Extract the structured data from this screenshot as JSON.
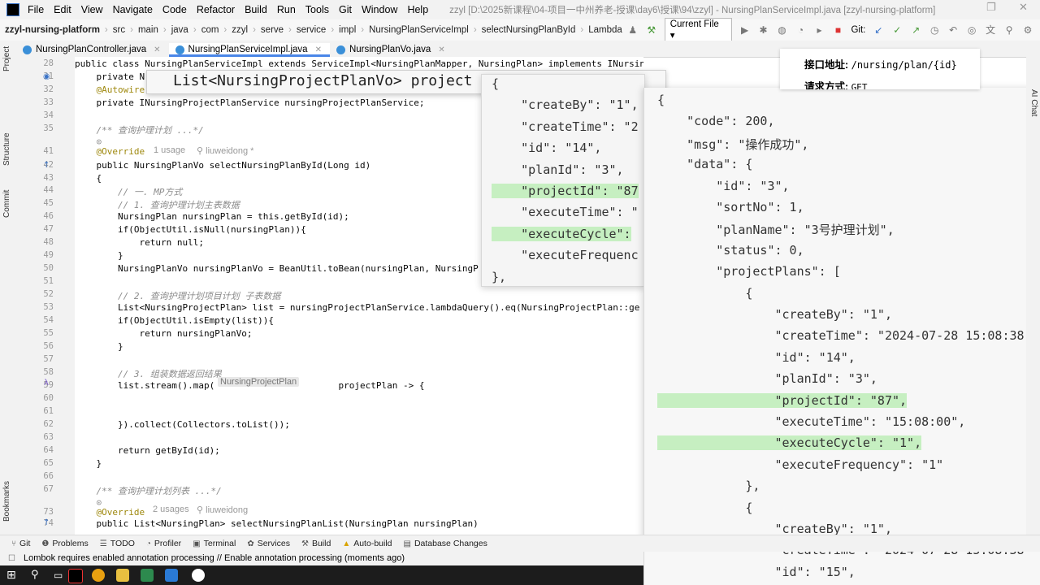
{
  "menubar": {
    "items": [
      "File",
      "Edit",
      "View",
      "Navigate",
      "Code",
      "Refactor",
      "Build",
      "Run",
      "Tools",
      "Git",
      "Window",
      "Help"
    ],
    "title": "zzyl [D:\\2025新课程\\04-项目一中州养老-授课\\day6\\授课\\94\\zzyl] - NursingPlanServiceImpl.java [zzyl-nursing-platform]"
  },
  "breadcrumb": [
    "zzyl-nursing-platform",
    "src",
    "main",
    "java",
    "com",
    "zzyl",
    "serve",
    "service",
    "impl",
    "NursingPlanServiceImpl",
    "selectNursingPlanById",
    "Lambda"
  ],
  "toolbar": {
    "current_file": "Current File",
    "git_label": "Git:"
  },
  "tabs": [
    "NursingPlanController.java",
    "NursingPlanServiceImpl.java",
    "NursingPlanVo.java"
  ],
  "sidebar_left": {
    "project": "Project",
    "structure": "Structure",
    "commit": "Commit",
    "bookmarks": "Bookmarks"
  },
  "sidebar_right": {
    "chat": "AI Chat"
  },
  "editor": {
    "lines": [
      {
        "n": "28",
        "text": "public class NursingPlanServiceImpl extends ServiceImpl<NursingPlanMapper, NursingPlan> implements INursingPlanService"
      },
      {
        "n": "31",
        "text": "    private N"
      },
      {
        "n": "32",
        "text": "    @Autowire"
      },
      {
        "n": "33",
        "text": "    private INursingProjectPlanService nursingProjectPlanService;"
      },
      {
        "n": "34",
        "text": ""
      },
      {
        "n": "35",
        "text": "    /** 查询护理计划 ...*/"
      },
      {
        "n": "",
        "text": "    ⊙"
      },
      {
        "n": "41",
        "text": "    @Override"
      },
      {
        "n": "42",
        "text": "    public NursingPlanVo selectNursingPlanById(Long id)"
      },
      {
        "n": "43",
        "text": "    {"
      },
      {
        "n": "44",
        "text": "        // 一. MP方式"
      },
      {
        "n": "45",
        "text": "        // 1. 查询护理计划主表数据"
      },
      {
        "n": "46",
        "text": "        NursingPlan nursingPlan = this.getById(id);"
      },
      {
        "n": "47",
        "text": "        if(ObjectUtil.isNull(nursingPlan)){"
      },
      {
        "n": "48",
        "text": "            return null;"
      },
      {
        "n": "49",
        "text": "        }"
      },
      {
        "n": "50",
        "text": "        NursingPlanVo nursingPlanVo = BeanUtil.toBean(nursingPlan, NursingP"
      },
      {
        "n": "51",
        "text": ""
      },
      {
        "n": "52",
        "text": "        // 2. 查询护理计划项目计划 子表数据"
      },
      {
        "n": "53",
        "text": "        List<NursingProjectPlan> list = nursingProjectPlanService.lambdaQuery().eq(NursingProjectPlan::ge"
      },
      {
        "n": "54",
        "text": "        if(ObjectUtil.isEmpty(list)){"
      },
      {
        "n": "55",
        "text": "            return nursingPlanVo;"
      },
      {
        "n": "56",
        "text": "        }"
      },
      {
        "n": "57",
        "text": ""
      },
      {
        "n": "58",
        "text": "        // 3. 组装数据返回结果"
      },
      {
        "n": "59",
        "text": "        list.stream().map(                       projectPlan -> {"
      },
      {
        "n": "60",
        "text": ""
      },
      {
        "n": "61",
        "text": ""
      },
      {
        "n": "62",
        "text": "        }).collect(Collectors.toList());"
      },
      {
        "n": "63",
        "text": ""
      },
      {
        "n": "64",
        "text": "        return getById(id);"
      },
      {
        "n": "65",
        "text": "    }"
      },
      {
        "n": "66",
        "text": ""
      },
      {
        "n": "67",
        "text": "    /** 查询护理计划列表 ...*/"
      },
      {
        "n": "",
        "text": "    ⊙"
      },
      {
        "n": "73",
        "text": "    @Override"
      },
      {
        "n": "74",
        "text": "    public List<NursingPlan> selectNursingPlanList(NursingPlan nursingPlan)"
      }
    ],
    "hints": {
      "usage1": "1 usage",
      "author1": "liuweidong *",
      "usage2": "2 usages",
      "author2": "liuweidong",
      "param_hint": "NursingProjectPlan"
    }
  },
  "type_popup": "List<NursingProjectPlanVo> project",
  "api_box": {
    "url_label": "接口地址:",
    "url": "/nursing/plan/{id}",
    "method_label": "请求方式:",
    "method": "GET"
  },
  "json_popup_small": [
    "{",
    "    \"createBy\": \"1\",",
    "    \"createTime\": \"2",
    "    \"id\": \"14\",",
    "    \"planId\": \"3\",",
    "    \"projectId\": \"87",
    "    \"executeTime\": \"",
    "    \"executeCycle\":",
    "    \"executeFrequenc",
    "},"
  ],
  "json_popup_large": [
    "{",
    "    \"code\": 200,",
    "    \"msg\": \"操作成功\",",
    "    \"data\": {",
    "        \"id\": \"3\",",
    "        \"sortNo\": 1,",
    "        \"planName\": \"3号护理计划\",",
    "        \"status\": 0,",
    "        \"projectPlans\": [",
    "            {",
    "                \"createBy\": \"1\",",
    "                \"createTime\": \"2024-07-28 15:08:38",
    "                \"id\": \"14\",",
    "                \"planId\": \"3\",",
    "                \"projectId\": \"87\",",
    "                \"executeTime\": \"15:08:00\",",
    "                \"executeCycle\": \"1\",",
    "                \"executeFrequency\": \"1\"",
    "            },",
    "            {",
    "                \"createBy\": \"1\",",
    "                \"createTime\": \"2024-07-28 15:08:38",
    "                \"id\": \"15\","
  ],
  "bottom_tools": [
    "Git",
    "Problems",
    "TODO",
    "Profiler",
    "Terminal",
    "Services",
    "Build",
    "Auto-build",
    "Database Changes"
  ],
  "status": "Lombok requires enabled annotation processing // Enable annotation processing (moments ago)"
}
